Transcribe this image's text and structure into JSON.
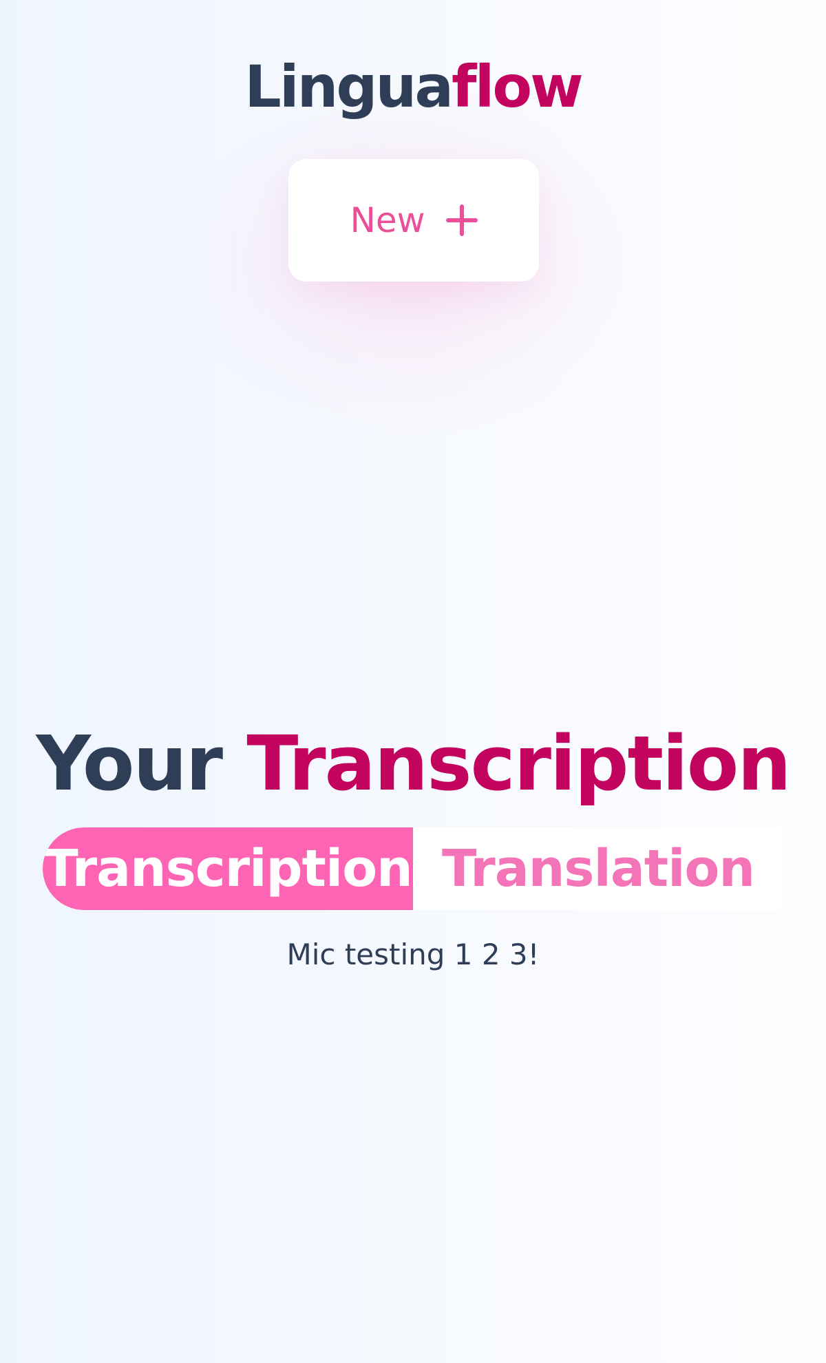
{
  "app": {
    "logo_part1": "Lingua",
    "logo_part2": "flow"
  },
  "new_button": {
    "label": "New",
    "icon": "plus-icon"
  },
  "heading": {
    "part1": "Your",
    "part2": "Transcription"
  },
  "tabs": [
    {
      "label": "Transcription",
      "active": true
    },
    {
      "label": "Translation",
      "active": false
    }
  ],
  "output": {
    "text": "Mic testing 1 2 3!"
  },
  "colors": {
    "dark": "#2e3e57",
    "brand": "#c2045e",
    "accent": "#fd65b4",
    "accent_text": "#ec4f9a"
  }
}
